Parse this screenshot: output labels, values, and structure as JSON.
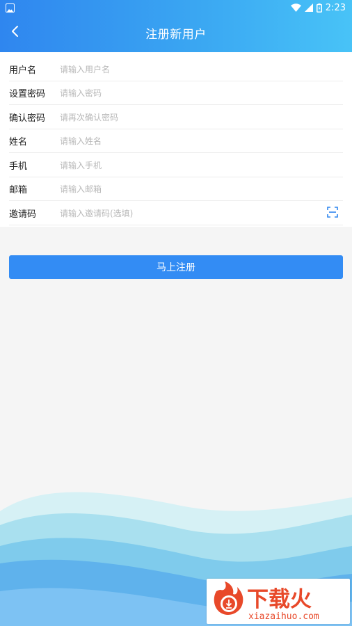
{
  "status_bar": {
    "time": "2:23"
  },
  "header": {
    "title": "注册新用户"
  },
  "form": {
    "fields": [
      {
        "label": "用户名",
        "placeholder": "请输入用户名",
        "value": ""
      },
      {
        "label": "设置密码",
        "placeholder": "请输入密码",
        "value": ""
      },
      {
        "label": "确认密码",
        "placeholder": "请再次确认密码",
        "value": ""
      },
      {
        "label": "姓名",
        "placeholder": "请输入姓名",
        "value": ""
      },
      {
        "label": "手机",
        "placeholder": "请输入手机",
        "value": ""
      },
      {
        "label": "邮箱",
        "placeholder": "请输入邮箱",
        "value": ""
      },
      {
        "label": "邀请码",
        "placeholder": "请输入邀请码(选填)",
        "value": ""
      }
    ],
    "submit_label": "马上注册"
  },
  "watermark": {
    "brand": "下载火",
    "domain": "xiazaihuo.com"
  },
  "colors": {
    "header_start": "#2f86ef",
    "header_end": "#48c3f7",
    "button": "#338cf4",
    "accent": "#2f86ef"
  },
  "icons": [
    "notification-icon",
    "wifi-icon",
    "signal-icon",
    "battery-icon",
    "back-arrow-icon",
    "scan-icon",
    "logo-icon"
  ]
}
